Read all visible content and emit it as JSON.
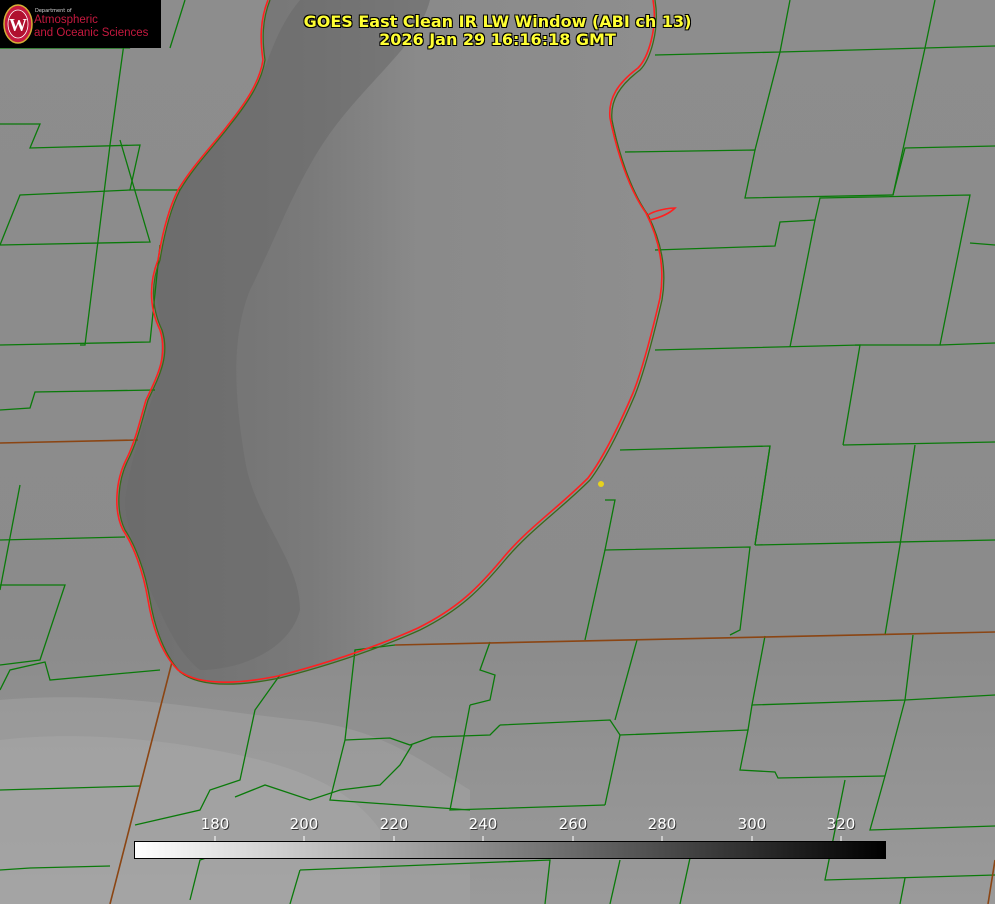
{
  "logo": {
    "department": "Department of",
    "line1": "Atmospheric",
    "line2": "and Oceanic Sciences",
    "seal_letter": "W"
  },
  "title": {
    "line1": "GOES East Clean IR LW Window (ABI ch 13)",
    "line2": "2026 Jan 29 16:16:18 GMT"
  },
  "colorbar": {
    "ticks": [
      "180",
      "200",
      "220",
      "240",
      "260",
      "280",
      "300",
      "320"
    ],
    "gradient_start": "#ffffff",
    "gradient_end": "#000000"
  },
  "colors": {
    "county_lines": "#0a7a0a",
    "state_lines": "#8b4513",
    "lake_outline": "#ff2020",
    "title_text": "#ffff33",
    "marker": "#e6d21e"
  }
}
